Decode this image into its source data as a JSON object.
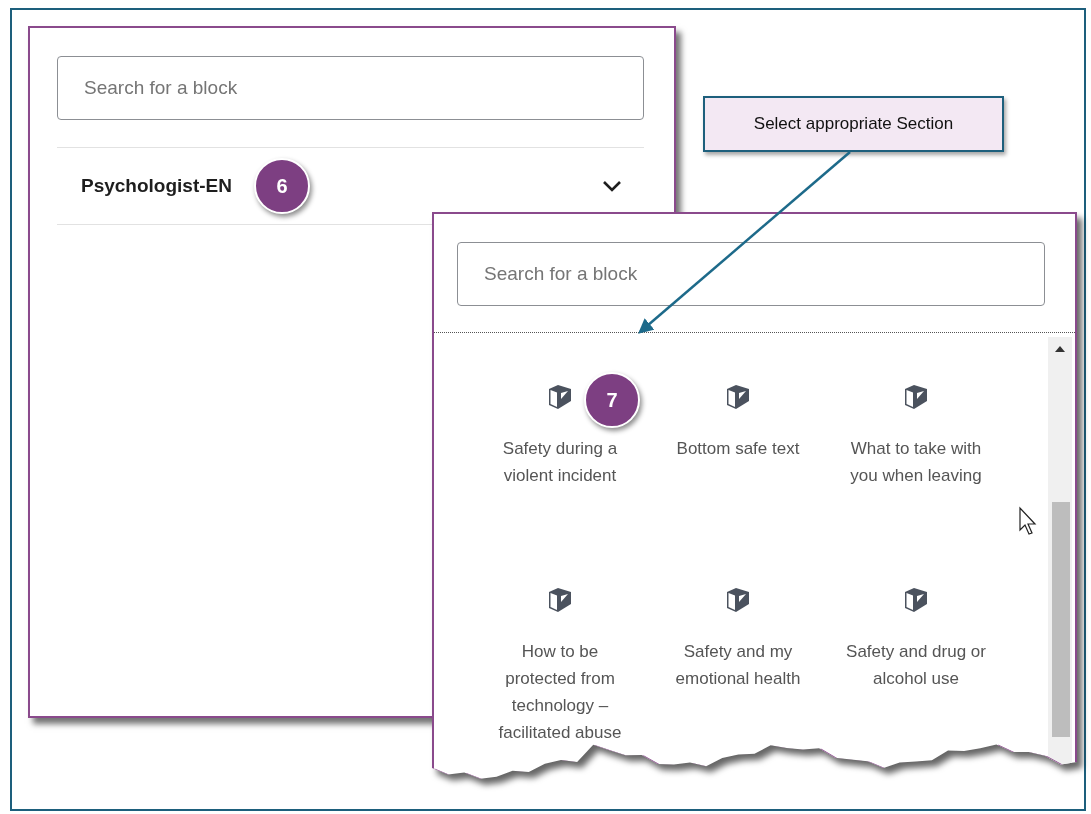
{
  "category_panel": {
    "search": {
      "placeholder": "Search for a block"
    },
    "category": {
      "label": "Psychologist-EN"
    },
    "step_badge": "6"
  },
  "callout": {
    "text": "Select appropriate Section"
  },
  "blocks_panel": {
    "search": {
      "placeholder": "Search for a block"
    },
    "step_badge": "7",
    "blocks": [
      {
        "label": "Safety during a violent incident"
      },
      {
        "label": "Bottom safe text"
      },
      {
        "label": "What to take with you when leaving"
      },
      {
        "label": "How to be protected from technology – facilitated abuse"
      },
      {
        "label": "Safety and my emotional health"
      },
      {
        "label": "Safety and drug or alcohol use"
      }
    ]
  }
}
